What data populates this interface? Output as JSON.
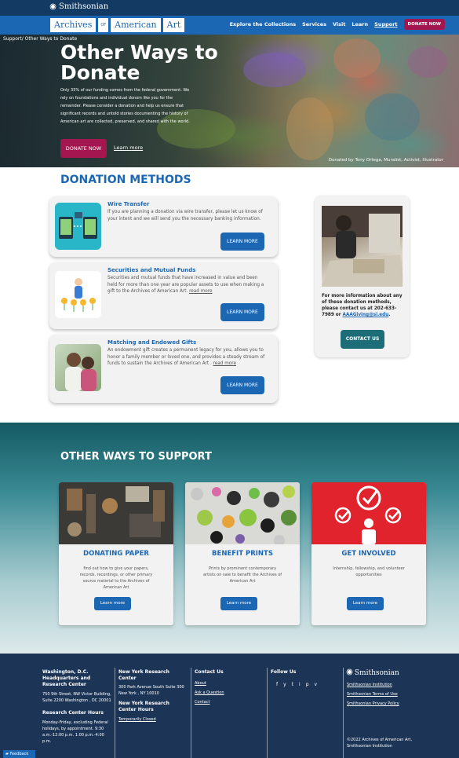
{
  "topbar": {
    "brand": "Smithsonian"
  },
  "nav": {
    "brand_left": "Archives",
    "brand_of": "OF",
    "brand_mid": "American",
    "brand_right": "Art",
    "links": [
      "Explore the Collections",
      "Services",
      "Visit",
      "Learn",
      "Support"
    ],
    "donate": "DONATE NOW"
  },
  "hero": {
    "breadcrumb": "Support/ Other Ways to Donate",
    "title": "Other Ways to Donate",
    "text": "Only 35% of our funding comes from the federal government. We rely on foundations and individual donors like you for the remainder. Please consider a donation and help us ensure that significant records and untold stories documenting the history of American art are collected, preserved, and shared with the world.",
    "button": "DONATE NOW",
    "link": "Learn more",
    "credit": "Donated by Tony Ortega, Muralist, Activist, Illustrator"
  },
  "methods": {
    "title": "DONATION METHODS",
    "cards": [
      {
        "title": "Wire Transfer",
        "desc": "If you are planning a donation via wire transfer, please let us know of your intent and we will send you the necessary banking information.",
        "readmore": "",
        "button": "LEARN MORE"
      },
      {
        "title": "Securities and Mutual Funds",
        "desc": "Securities and mutual funds that have increased in value and been held for more than one year are popular assets to use when making a gift to the Archives of American Art.",
        "readmore": "read more",
        "button": "LEARN MORE"
      },
      {
        "title": "Matching and Endowed Gifts",
        "desc": "An endowment gift creates a permanent legacy for you, allows you to honor a family member or loved one, and provides a steady stream of funds to sustain the Archives of American Art .",
        "readmore": "read more",
        "button": "LEARN MORE"
      }
    ],
    "side": {
      "text": "For more information about any of these donation methods, please contact us at 202-633-7989 or",
      "email": "AAAGiving@si.edu",
      "button": "CONTACT US"
    }
  },
  "other": {
    "title": "OTHER WAYS TO SUPPORT",
    "cards": [
      {
        "title": "DONATING PAPER",
        "desc": "find out how to give your papers, records, recordings, or other primary source material to the Archives of American Art",
        "button": "Learn more"
      },
      {
        "title": "BENEFIT PRINTS",
        "desc": "Prints by prominent contemporary artists on sale to benefit the Archives of American Art",
        "button": "Learn more"
      },
      {
        "title": "GET INVOLVED",
        "desc": "Internship, fellowship, and volunteer opportunities",
        "button": "Learn more"
      }
    ]
  },
  "footer": {
    "dc_title": "Washington, D.C. Headquarters and Research Center",
    "dc_address": "750 9th Street, NW Victor Building, Suite 2200 Washington , DC 20001",
    "hours_title": "Research Center Hours",
    "hours_text": "Monday-Friday, excluding Federal holidays, by appointment. 9:30 a.m.-12:00 p.m. 1:00 p.m.-4:00 p.m.",
    "ny_title": "New York Research Center",
    "ny_address": "300 Park Avenue South Suite 300 New York , NY 10010",
    "ny_hours_title": "New York Research Center Hours",
    "ny_hours_link": "Temporarily Closed",
    "contact_title": "Contact Us",
    "contact_links": [
      "About",
      "Ask a Question",
      "Contact"
    ],
    "follow_title": "Follow Us",
    "social": [
      "f",
      "y",
      "t",
      "i",
      "p",
      "v"
    ],
    "si_title": "Smithsonian",
    "si_links": [
      "Smithsonian Institution",
      "Smithsonian Terms of Use",
      "Smithsonian Privacy Policy"
    ],
    "copyright": "©2022 Archives of American Art, Smithsonian Institution"
  },
  "feedback": "Feedback"
}
